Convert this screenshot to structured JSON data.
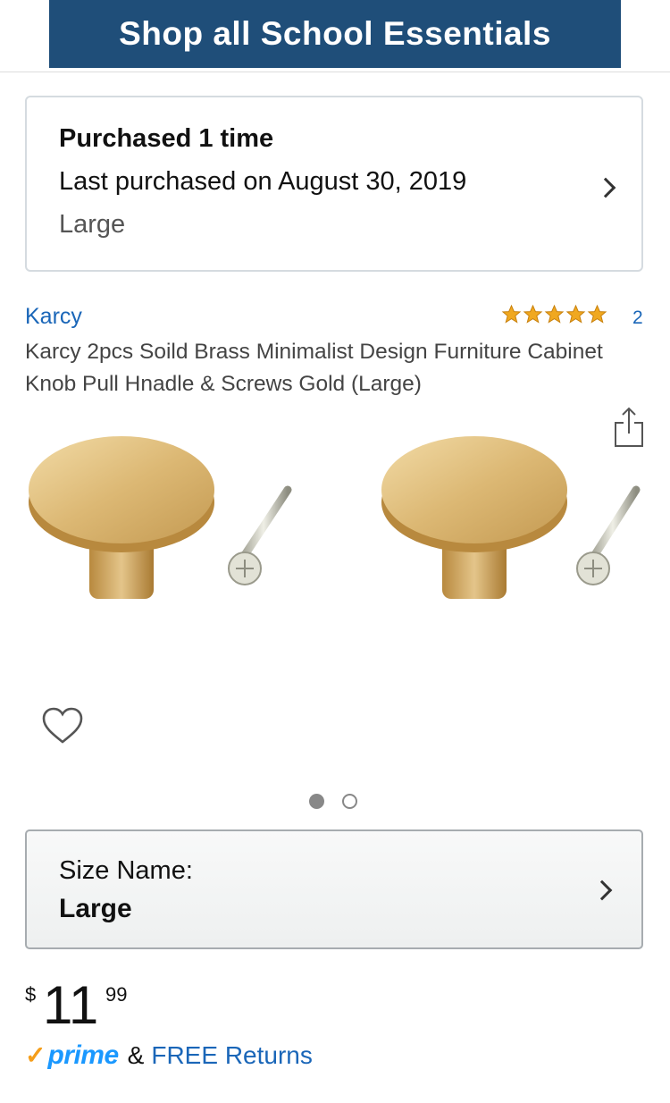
{
  "banner": {
    "text": "Shop all School Essentials"
  },
  "purchase_history": {
    "title": "Purchased 1 time",
    "last_purchased": "Last purchased on August 30, 2019",
    "variant": "Large"
  },
  "product": {
    "brand": "Karcy",
    "rating": 5,
    "review_count": "2",
    "title": "Karcy 2pcs Soild Brass Minimalist Design Furniture Cabinet Knob Pull Hnadle & Screws Gold (Large)",
    "image_count": 2,
    "active_image": 1
  },
  "size_selector": {
    "label": "Size Name:",
    "value": "Large"
  },
  "price": {
    "symbol": "$",
    "whole": "11",
    "fraction": "99"
  },
  "prime": {
    "check": "✓",
    "word": "prime",
    "amp": "&",
    "free_returns": "FREE Returns"
  },
  "icons": [
    "chevron-right-icon",
    "star-icon",
    "share-icon",
    "heart-icon"
  ],
  "colors": {
    "banner": "#1f4e79",
    "link": "#1a66b8",
    "star": "#f0a820",
    "prime": "#1a98ff",
    "prime_check": "#f59e1b"
  }
}
